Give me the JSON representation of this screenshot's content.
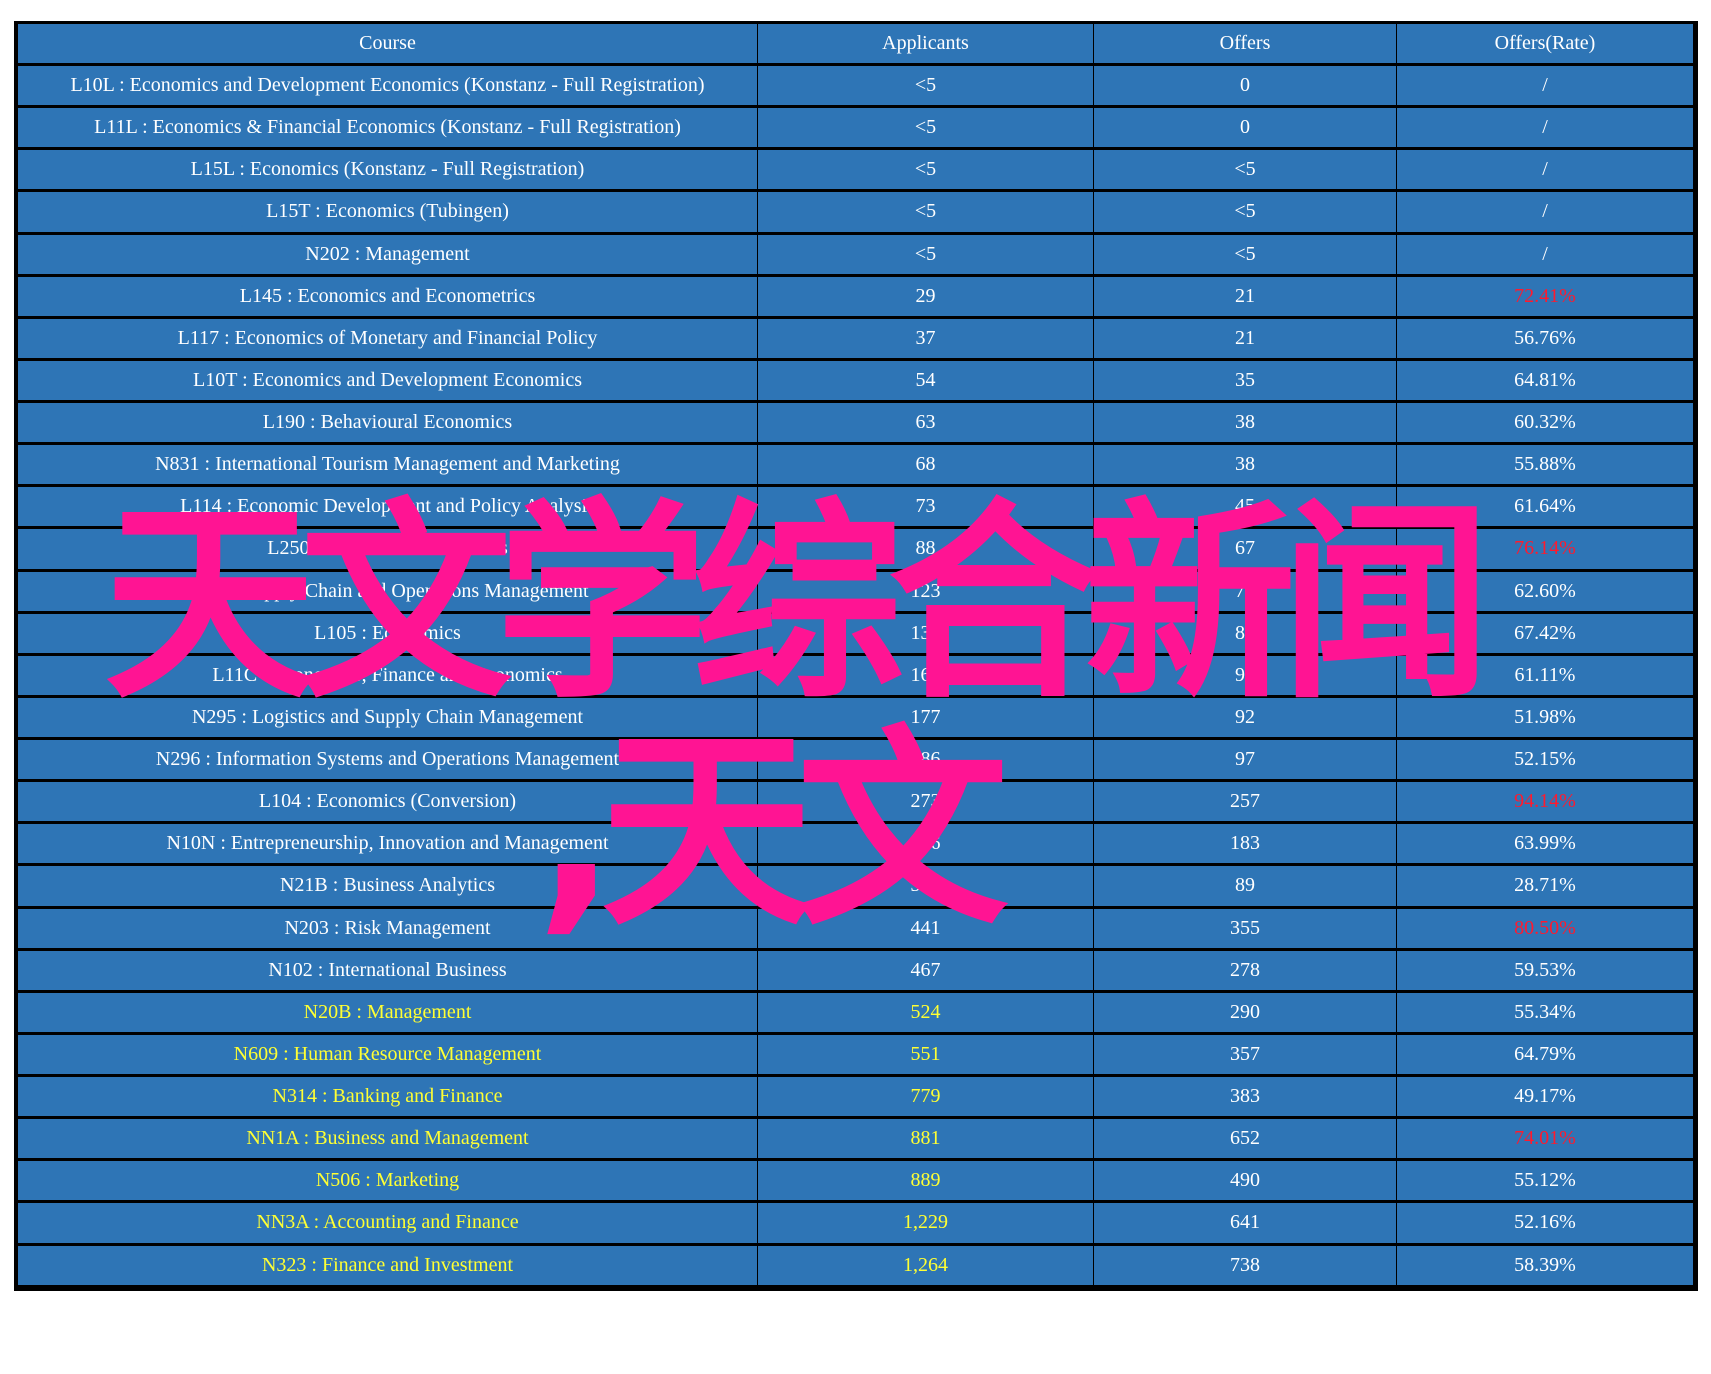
{
  "table": {
    "headers": [
      "Course",
      "Applicants",
      "Offers",
      "Offers(Rate)"
    ],
    "rows": [
      {
        "course": "L10L : Economics and Development Economics (Konstanz - Full Registration)",
        "applicants": "<5",
        "offers": "0",
        "rate": "/",
        "highlight": "none",
        "rate_alert": false
      },
      {
        "course": "L11L : Economics & Financial Economics (Konstanz - Full Registration)",
        "applicants": "<5",
        "offers": "0",
        "rate": "/",
        "highlight": "none",
        "rate_alert": false
      },
      {
        "course": "L15L : Economics (Konstanz - Full Registration)",
        "applicants": "<5",
        "offers": "<5",
        "rate": "/",
        "highlight": "none",
        "rate_alert": false
      },
      {
        "course": "L15T : Economics (Tubingen)",
        "applicants": "<5",
        "offers": "<5",
        "rate": "/",
        "highlight": "none",
        "rate_alert": false
      },
      {
        "course": "N202 : Management",
        "applicants": "<5",
        "offers": "<5",
        "rate": "/",
        "highlight": "none",
        "rate_alert": false
      },
      {
        "course": "L145 : Economics and Econometrics",
        "applicants": "29",
        "offers": "21",
        "rate": "72.41%",
        "highlight": "none",
        "rate_alert": true
      },
      {
        "course": "L117 : Economics of Monetary and Financial Policy",
        "applicants": "37",
        "offers": "21",
        "rate": "56.76%",
        "highlight": "none",
        "rate_alert": false
      },
      {
        "course": "L10T : Economics and Development Economics",
        "applicants": "54",
        "offers": "35",
        "rate": "64.81%",
        "highlight": "none",
        "rate_alert": false
      },
      {
        "course": "L190 : Behavioural Economics",
        "applicants": "63",
        "offers": "38",
        "rate": "60.32%",
        "highlight": "none",
        "rate_alert": false
      },
      {
        "course": "N831 : International Tourism Management and Marketing",
        "applicants": "68",
        "offers": "38",
        "rate": "55.88%",
        "highlight": "none",
        "rate_alert": false
      },
      {
        "course": "L114 : Economic Development and Policy Analysis",
        "applicants": "73",
        "offers": "45",
        "rate": "61.64%",
        "highlight": "none",
        "rate_alert": false
      },
      {
        "course": "L250 : International Relations",
        "applicants": "88",
        "offers": "67",
        "rate": "76.14%",
        "highlight": "none",
        "rate_alert": true
      },
      {
        "course": "N??? : Supply Chain and Operations Management",
        "applicants": "123",
        "offers": "77",
        "rate": "62.60%",
        "highlight": "none",
        "rate_alert": false
      },
      {
        "course": "L105 : Economics",
        "applicants": "132",
        "offers": "89",
        "rate": "67.42%",
        "highlight": "none",
        "rate_alert": false
      },
      {
        "course": "L11C : Economics, Finance and Economics",
        "applicants": "162",
        "offers": "99",
        "rate": "61.11%",
        "highlight": "none",
        "rate_alert": false
      },
      {
        "course": "N295 : Logistics and Supply Chain Management",
        "applicants": "177",
        "offers": "92",
        "rate": "51.98%",
        "highlight": "none",
        "rate_alert": false
      },
      {
        "course": "N296 : Information Systems and Operations Management",
        "applicants": "186",
        "offers": "97",
        "rate": "52.15%",
        "highlight": "none",
        "rate_alert": false
      },
      {
        "course": "L104 : Economics (Conversion)",
        "applicants": "273",
        "offers": "257",
        "rate": "94.14%",
        "highlight": "none",
        "rate_alert": true
      },
      {
        "course": "N10N : Entrepreneurship, Innovation and Management",
        "applicants": "286",
        "offers": "183",
        "rate": "63.99%",
        "highlight": "none",
        "rate_alert": false
      },
      {
        "course": "N21B : Business Analytics",
        "applicants": "310",
        "offers": "89",
        "rate": "28.71%",
        "highlight": "none",
        "rate_alert": false
      },
      {
        "course": "N203 : Risk Management",
        "applicants": "441",
        "offers": "355",
        "rate": "80.50%",
        "highlight": "none",
        "rate_alert": true
      },
      {
        "course": "N102 : International Business",
        "applicants": "467",
        "offers": "278",
        "rate": "59.53%",
        "highlight": "none",
        "rate_alert": false
      },
      {
        "course": "N20B : Management",
        "applicants": "524",
        "offers": "290",
        "rate": "55.34%",
        "highlight": "yellow",
        "rate_alert": false
      },
      {
        "course": "N609 : Human Resource Management",
        "applicants": "551",
        "offers": "357",
        "rate": "64.79%",
        "highlight": "yellow",
        "rate_alert": false
      },
      {
        "course": "N314 : Banking and Finance",
        "applicants": "779",
        "offers": "383",
        "rate": "49.17%",
        "highlight": "yellow",
        "rate_alert": false
      },
      {
        "course": "NN1A : Business and Management",
        "applicants": "881",
        "offers": "652",
        "rate": "74.01%",
        "highlight": "yellow",
        "rate_alert": true
      },
      {
        "course": "N506 : Marketing",
        "applicants": "889",
        "offers": "490",
        "rate": "55.12%",
        "highlight": "yellow",
        "rate_alert": false
      },
      {
        "course": "NN3A : Accounting and Finance",
        "applicants": "1,229",
        "offers": "641",
        "rate": "52.16%",
        "highlight": "yellow",
        "rate_alert": false
      },
      {
        "course": "N323 : Finance and Investment",
        "applicants": "1,264",
        "offers": "738",
        "rate": "58.39%",
        "highlight": "yellow",
        "rate_alert": false
      }
    ]
  },
  "overlay": {
    "line1": "天文学综合新闻",
    "line2": ",天文"
  },
  "colors": {
    "cell_bg": "#2E75B6",
    "text_default": "#FFFFFF",
    "text_highlight": "#FFFF33",
    "rate_alert": "#FF1A2E",
    "overlay": "#FF1493",
    "border": "#000000"
  }
}
